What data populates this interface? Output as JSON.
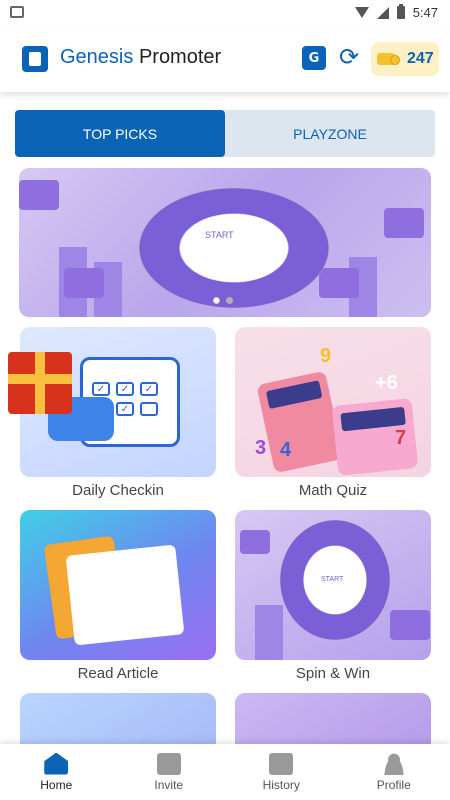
{
  "status_bar": {
    "time": "5:47"
  },
  "header": {
    "title_part1": "Genesis",
    "title_part2": "Promoter",
    "translate_icon": "G",
    "coin_count": "247"
  },
  "tabs": [
    {
      "label": "TOP PICKS",
      "active": true
    },
    {
      "label": "PLAYZONE",
      "active": false
    }
  ],
  "banner": {
    "wheel_text": "START",
    "pages": 2,
    "current_page": 1
  },
  "cards": [
    {
      "label": "Daily Checkin"
    },
    {
      "label": "Math Quiz"
    },
    {
      "label": "Read Article"
    },
    {
      "label": "Spin & Win"
    }
  ],
  "spin_card": {
    "wheel_text": "START"
  },
  "bottom_nav": [
    {
      "label": "Home",
      "icon": "home-icon",
      "active": true
    },
    {
      "label": "Invite",
      "icon": "gift-icon",
      "active": false
    },
    {
      "label": "History",
      "icon": "history-icon",
      "active": false
    },
    {
      "label": "Profile",
      "icon": "profile-icon",
      "active": false
    }
  ],
  "colors": {
    "primary": "#0b63b6",
    "coin_bg": "#fdf0c4"
  }
}
